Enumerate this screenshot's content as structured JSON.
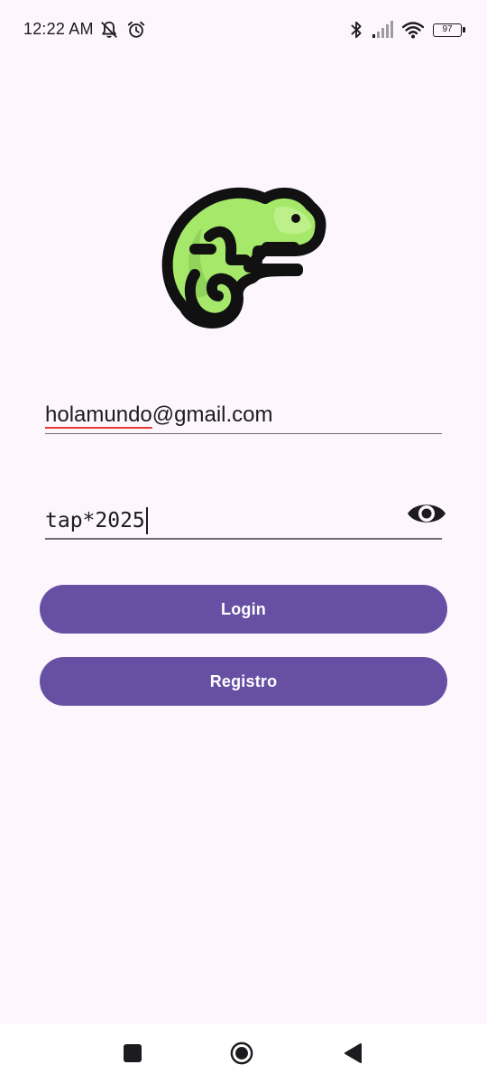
{
  "status_bar": {
    "time": "12:22 AM",
    "left_icons": [
      "muted-notifications-icon",
      "alarm-icon"
    ],
    "right_icons": [
      "bluetooth-icon",
      "signal-icon",
      "wifi-icon"
    ],
    "battery_level": "97"
  },
  "logo": {
    "icon": "chameleon-logo-icon"
  },
  "login_form": {
    "email": {
      "value_local": "holamundo",
      "value_domain": "@gmail.com"
    },
    "password": {
      "value": "tap*2025",
      "visibility_icon": "eye-icon"
    }
  },
  "buttons": {
    "login_label": "Login",
    "register_label": "Registro"
  },
  "navigation_bar": {
    "icons": [
      "recents-icon",
      "home-icon",
      "back-icon"
    ]
  },
  "colors": {
    "background": "#fdf6fd",
    "button": "#6750a4",
    "logo_green": "#a6e86a",
    "spellcheck_underline": "#e53935"
  }
}
